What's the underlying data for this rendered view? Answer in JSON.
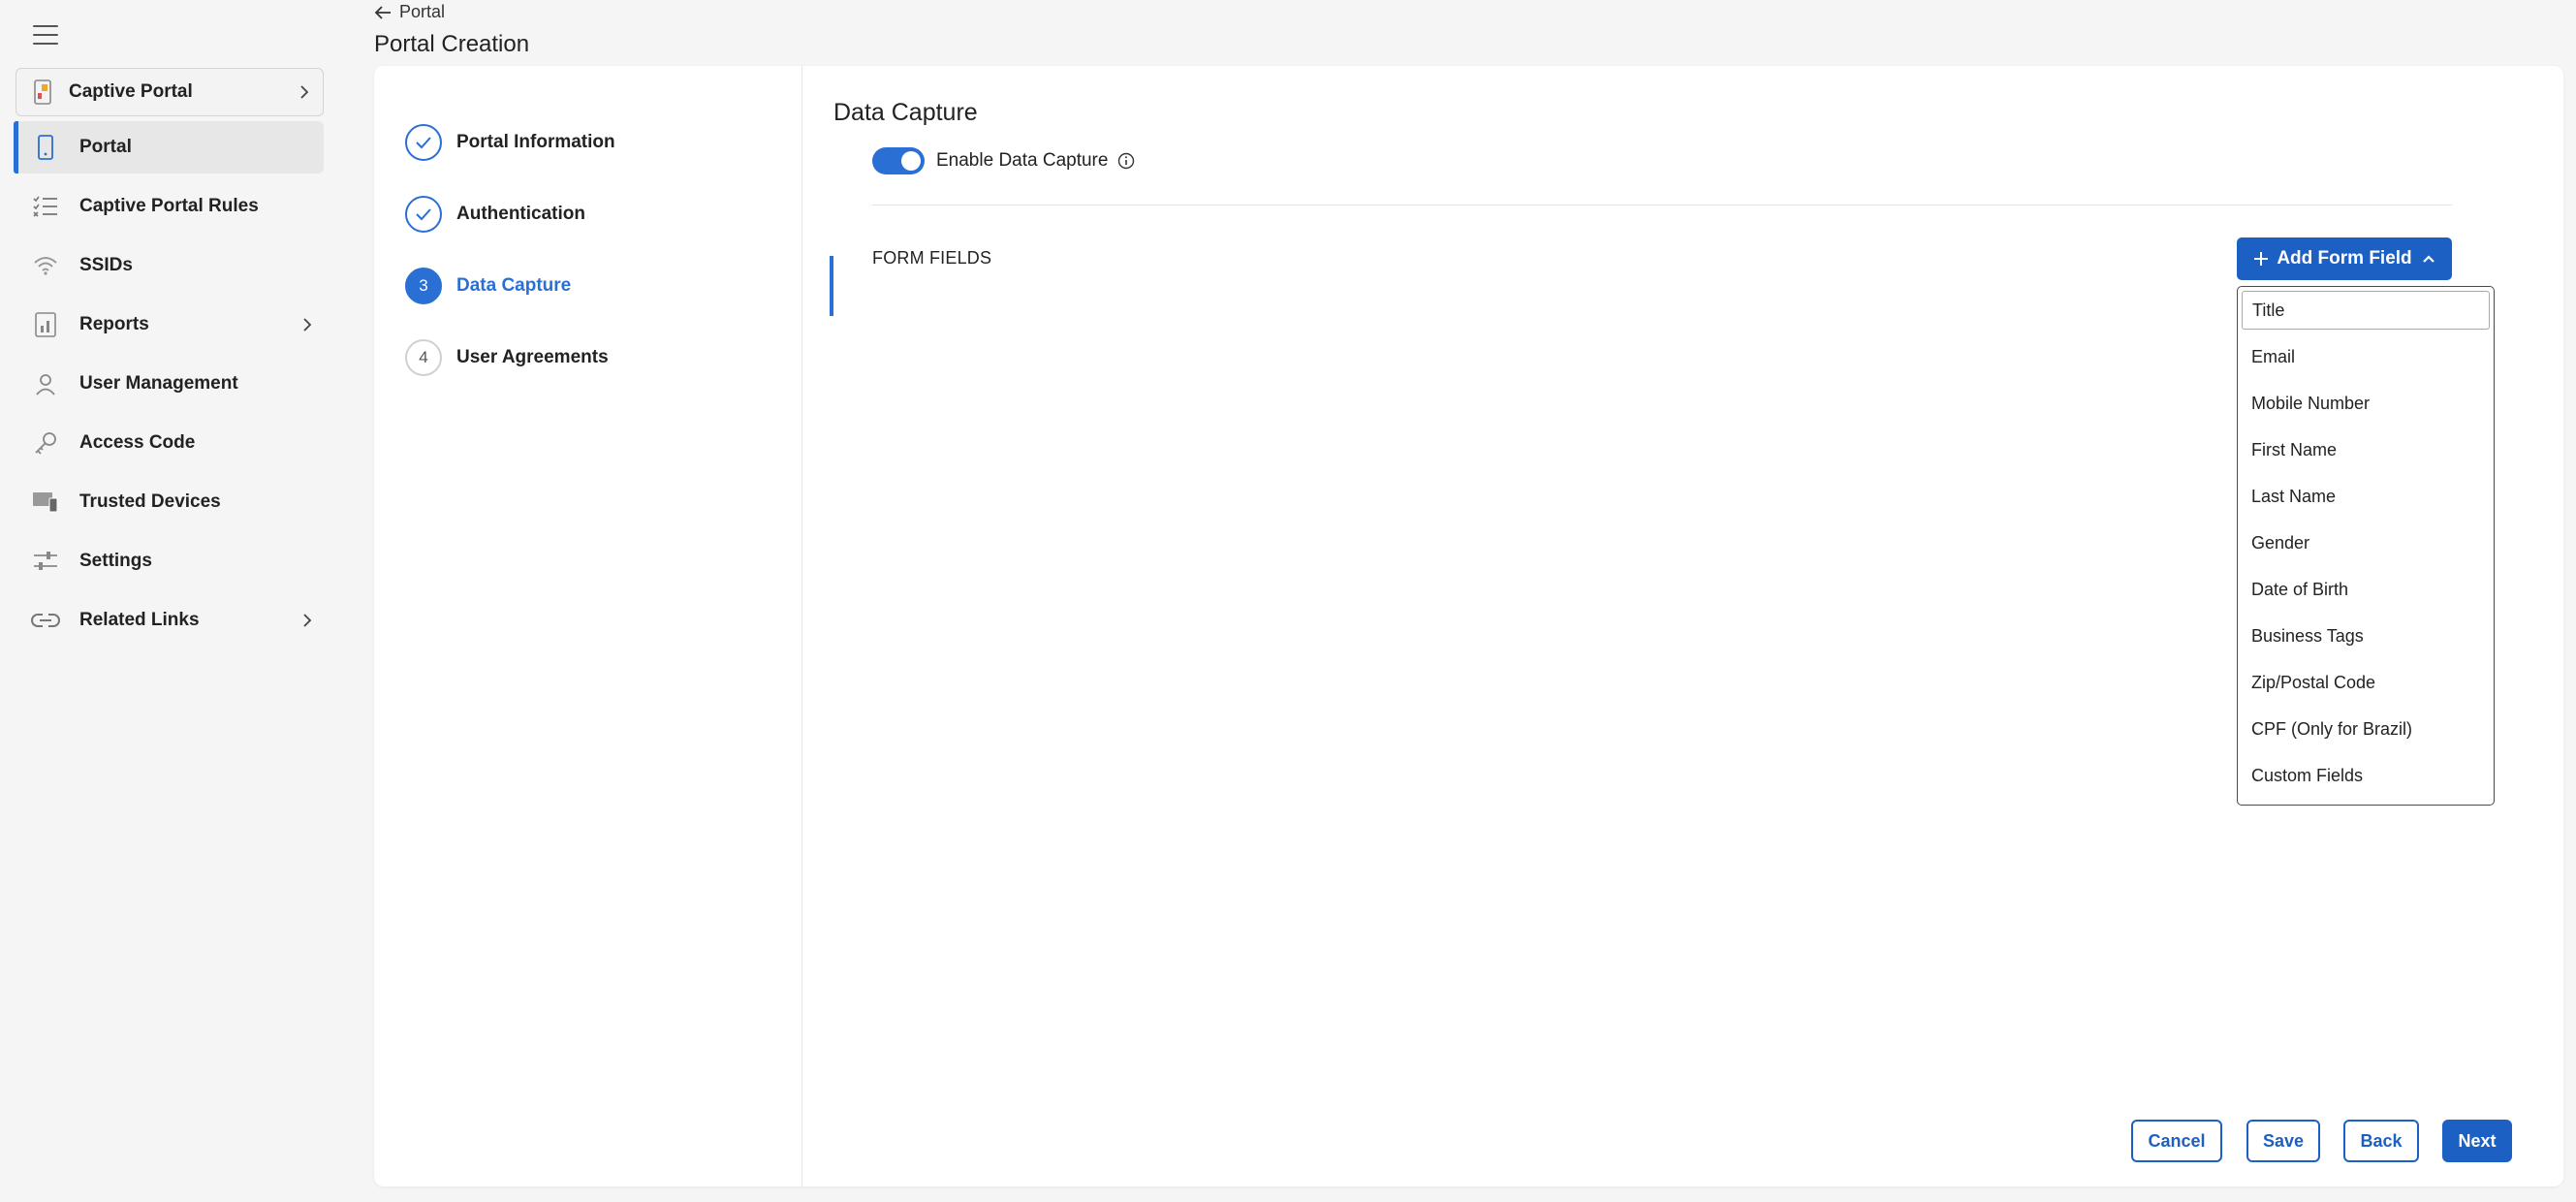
{
  "sidebar": {
    "product_switcher": {
      "label": "Captive Portal"
    },
    "items": [
      {
        "label": "Portal",
        "icon": "mobile-icon",
        "active": true
      },
      {
        "label": "Captive Portal Rules",
        "icon": "checklist-icon"
      },
      {
        "label": "SSIDs",
        "icon": "wifi-icon"
      },
      {
        "label": "Reports",
        "icon": "report-icon",
        "has_submenu": true
      },
      {
        "label": "User Management",
        "icon": "user-icon"
      },
      {
        "label": "Access Code",
        "icon": "key-icon"
      },
      {
        "label": "Trusted Devices",
        "icon": "devices-icon"
      },
      {
        "label": "Settings",
        "icon": "sliders-icon"
      },
      {
        "label": "Related Links",
        "icon": "link-icon",
        "has_submenu": true
      }
    ]
  },
  "header": {
    "back_label": "Portal",
    "title": "Portal Creation"
  },
  "steps": [
    {
      "number": "1",
      "label": "Portal Information",
      "status": "complete"
    },
    {
      "number": "2",
      "label": "Authentication",
      "status": "complete"
    },
    {
      "number": "3",
      "label": "Data Capture",
      "status": "current"
    },
    {
      "number": "4",
      "label": "User Agreements",
      "status": "pending"
    }
  ],
  "data_capture": {
    "title": "Data Capture",
    "toggle_label": "Enable Data Capture",
    "toggle_on": true,
    "form_fields_label": "FORM FIELDS",
    "add_button_label": "Add Form Field",
    "dropdown_options": [
      "Title",
      "Email",
      "Mobile Number",
      "First Name",
      "Last Name",
      "Gender",
      "Date of Birth",
      "Business Tags",
      "Zip/Postal Code",
      "CPF (Only for Brazil)",
      "Custom Fields"
    ]
  },
  "footer": {
    "cancel": "Cancel",
    "save": "Save",
    "back": "Back",
    "next": "Next"
  },
  "colors": {
    "accent": "#1d60c4",
    "active_indicator": "#2a6fd3"
  }
}
